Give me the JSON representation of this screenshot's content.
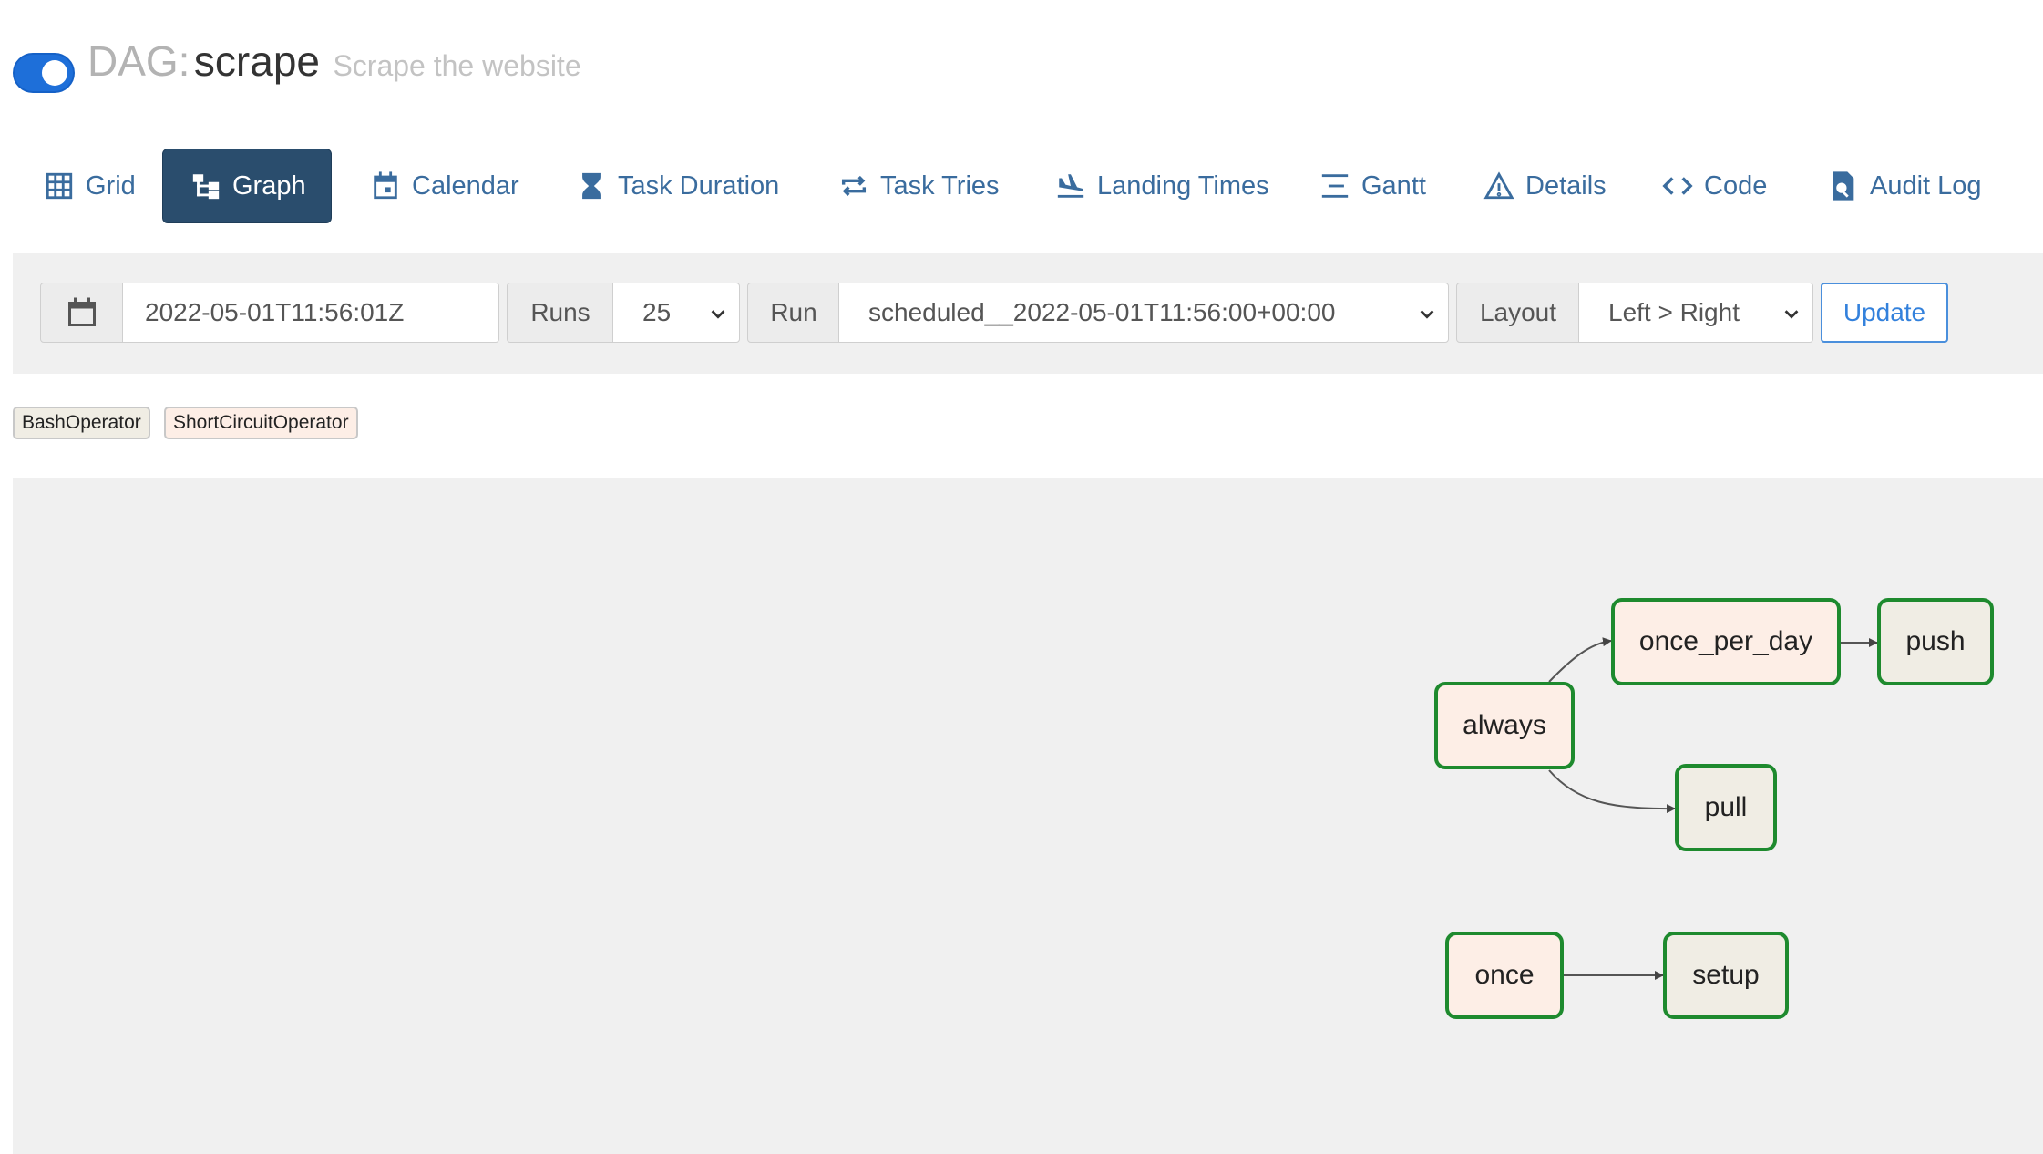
{
  "header": {
    "dag_label": "DAG:",
    "dag_id": "scrape",
    "description": "Scrape the website",
    "paused_toggle": "on"
  },
  "nav": {
    "tabs": [
      {
        "label": "Grid",
        "icon": "grid-icon"
      },
      {
        "label": "Graph",
        "icon": "graph-icon",
        "active": true
      },
      {
        "label": "Calendar",
        "icon": "calendar-icon"
      },
      {
        "label": "Task Duration",
        "icon": "hourglass-icon"
      },
      {
        "label": "Task Tries",
        "icon": "retry-icon"
      },
      {
        "label": "Landing Times",
        "icon": "landing-icon"
      },
      {
        "label": "Gantt",
        "icon": "gantt-icon"
      },
      {
        "label": "Details",
        "icon": "warning-triangle-icon"
      },
      {
        "label": "Code",
        "icon": "code-icon"
      },
      {
        "label": "Audit Log",
        "icon": "file-search-icon"
      }
    ]
  },
  "toolbar": {
    "base_date": "2022-05-01T11:56:01Z",
    "runs_label": "Runs",
    "runs_value": "25",
    "run_label": "Run",
    "run_value": "scheduled__2022-05-01T11:56:00+00:00",
    "layout_label": "Layout",
    "layout_value": "Left > Right",
    "update_label": "Update"
  },
  "legend": {
    "operators": [
      {
        "label": "BashOperator",
        "color": "#f0ede4"
      },
      {
        "label": "ShortCircuitOperator",
        "color": "#fdeee6"
      }
    ]
  },
  "graph": {
    "nodes": [
      {
        "id": "always",
        "label": "always",
        "operator": "ShortCircuitOperator"
      },
      {
        "id": "once_per_day",
        "label": "once_per_day",
        "operator": "ShortCircuitOperator"
      },
      {
        "id": "push",
        "label": "push",
        "operator": "BashOperator"
      },
      {
        "id": "pull",
        "label": "pull",
        "operator": "BashOperator"
      },
      {
        "id": "once",
        "label": "once",
        "operator": "ShortCircuitOperator"
      },
      {
        "id": "setup",
        "label": "setup",
        "operator": "BashOperator"
      }
    ],
    "edges": [
      [
        "always",
        "once_per_day"
      ],
      [
        "once_per_day",
        "push"
      ],
      [
        "always",
        "pull"
      ],
      [
        "once",
        "setup"
      ]
    ],
    "status_border_color": "#1e8a2e"
  },
  "colors": {
    "accent": "#2a4d6d",
    "link": "#3a6c9e",
    "toggle": "#1e6fd9",
    "update": "#3381dc"
  }
}
